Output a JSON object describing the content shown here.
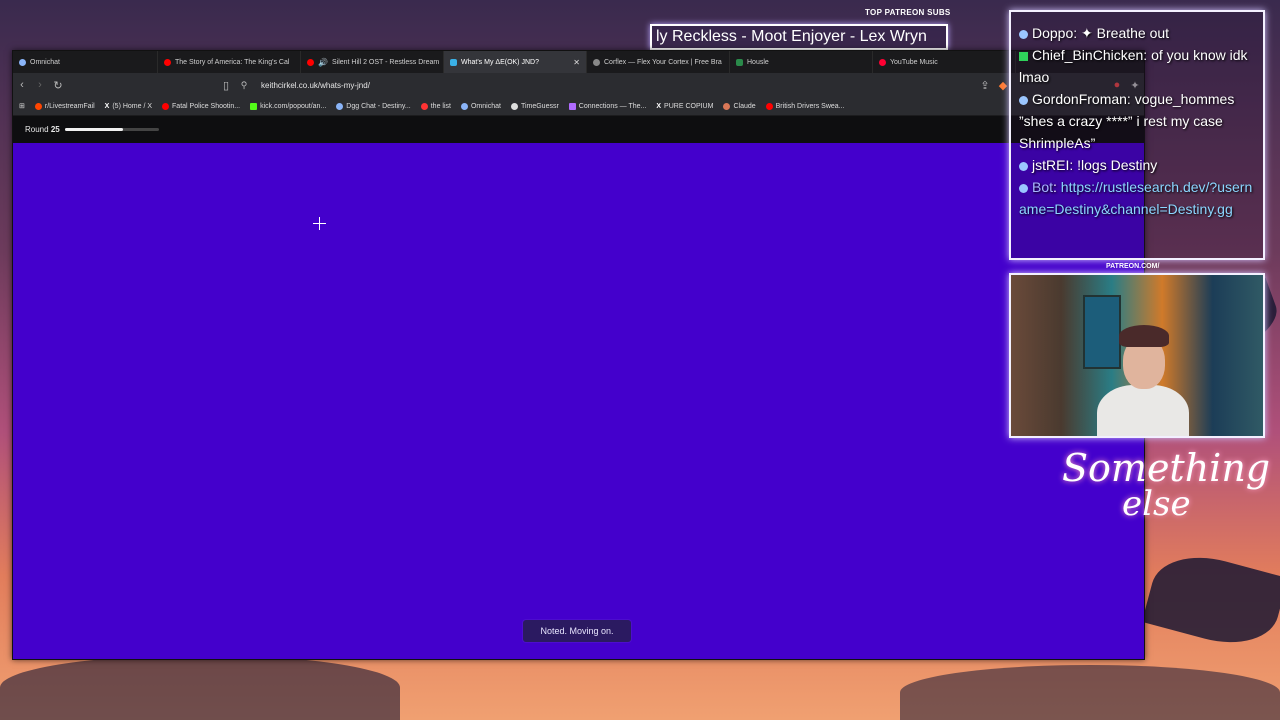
{
  "overlay": {
    "patreon_label": "TOP PATREON SUBS",
    "ticker_text": "ly Reckless - Moot Enjoyer - Lex Wryn",
    "cam_patreon_label": "PATREON.COM/",
    "logo_text_line1": "Something",
    "logo_text_line2": "else"
  },
  "browser": {
    "tabs": [
      {
        "label": "Omnichat",
        "icon": "omnichat-icon",
        "color": "#8ab4f8",
        "active": false
      },
      {
        "label": "The Story of America: The King's Cal",
        "icon": "youtube-icon",
        "color": "#ff0000",
        "active": false
      },
      {
        "label": "Silent Hill 2 OST - Restless Dream",
        "icon": "youtube-icon",
        "color": "#ff0000",
        "active": false
      },
      {
        "label": "What's My ΔE(OK) JND?",
        "icon": "site-icon",
        "color": "#3ab0e6",
        "active": true
      },
      {
        "label": "Corflex — Flex Your Cortex | Free Bra",
        "icon": "site-icon",
        "color": "#888888",
        "active": false
      },
      {
        "label": "Housle",
        "icon": "site-icon",
        "color": "#2a8a4a",
        "active": false
      },
      {
        "label": "YouTube Music",
        "icon": "youtube-music-icon",
        "color": "#ff0033",
        "active": false
      }
    ],
    "url": "keithcirkel.co.uk/whats-my-jnd/",
    "bookmarks": [
      {
        "label": "r/LivestreamFail",
        "color": "#ff4500"
      },
      {
        "label": "(5) Home / X",
        "color": "#ffffff"
      },
      {
        "label": "Fatal Police Shootin...",
        "color": "#ff0000"
      },
      {
        "label": "kick.com/popout/an...",
        "color": "#53fc18"
      },
      {
        "label": "Dgg Chat - Destiny...",
        "color": "#8ab4f8"
      },
      {
        "label": "the list",
        "color": "#ff3333"
      },
      {
        "label": "Omnichat",
        "color": "#8ab4f8"
      },
      {
        "label": "TimeGuessr",
        "color": "#dddddd"
      },
      {
        "label": "Connections — The...",
        "color": "#b06bff"
      },
      {
        "label": "PURE COPIUM",
        "color": "#ffffff"
      },
      {
        "label": "Claude",
        "color": "#d97757"
      },
      {
        "label": "British Drivers Swea...",
        "color": "#ff0000"
      }
    ],
    "page": {
      "round_label": "Round",
      "round_number": "25",
      "progress": 0.62,
      "canvas_color": "#4400cc",
      "toast_text": "Noted. Moving on."
    }
  },
  "chat": {
    "messages": [
      {
        "user": "Doppo:",
        "text": "Breathe out",
        "badge": "dgg"
      },
      {
        "user": "Chief_BinChicken:",
        "text": "of you know idk lmao",
        "badge": "kick"
      },
      {
        "user": "GordonFroman:",
        "text": "vogue_hommes ”shes a crazy ****” i rest my case ShrimpleAs”",
        "badge": "dgg"
      },
      {
        "user": "jstREI:",
        "text": "!logs Destiny",
        "badge": "dgg"
      },
      {
        "user": "Bot",
        "text": "https://rustlesearch.dev/?username=Destiny&channel=Destiny.gg",
        "badge": "dgg"
      }
    ]
  }
}
